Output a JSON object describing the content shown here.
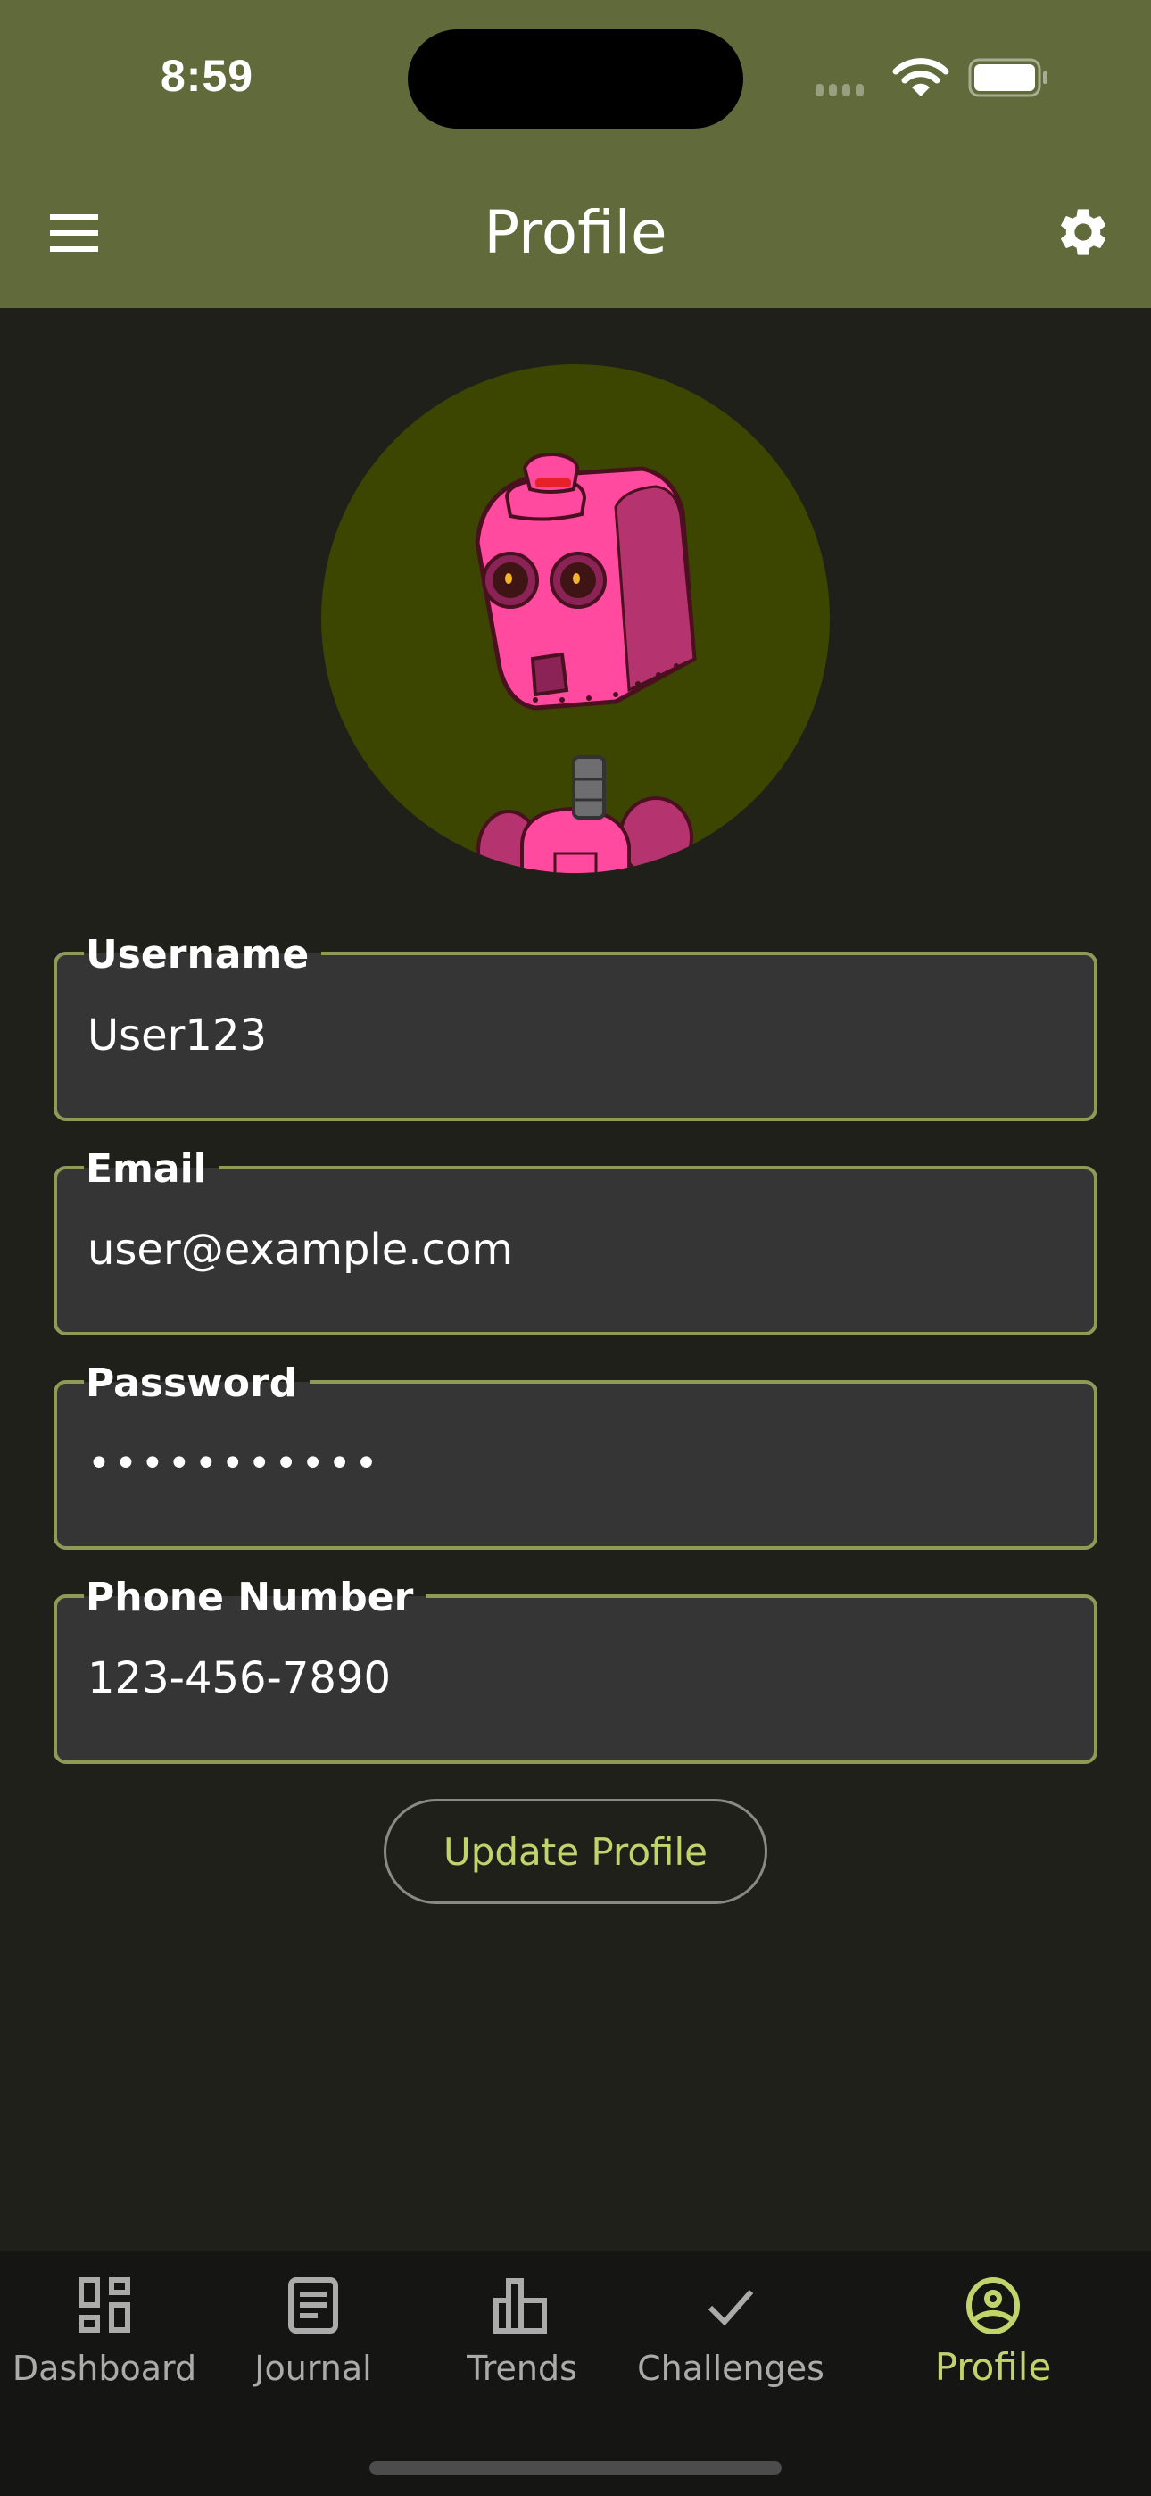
{
  "status_bar": {
    "time": "8:59"
  },
  "app_bar": {
    "title": "Profile",
    "menu_icon": "hamburger-menu-icon",
    "settings_icon": "gear-icon"
  },
  "avatar": {
    "description": "pink cartoon robot avatar",
    "background_color": "#3c4600"
  },
  "form": {
    "fields": [
      {
        "label": "Username",
        "value": "User123"
      },
      {
        "label": "Email",
        "value": "user@example.com"
      },
      {
        "label": "Password",
        "value": "•••••••••••"
      },
      {
        "label": "Phone Number",
        "value": "123-456-7890"
      }
    ],
    "submit_label": "Update Profile"
  },
  "bottom_nav": {
    "items": [
      {
        "label": "Dashboard",
        "icon": "dashboard-icon",
        "active": false
      },
      {
        "label": "Journal",
        "icon": "journal-icon",
        "active": false
      },
      {
        "label": "Trends",
        "icon": "bar-chart-icon",
        "active": false
      },
      {
        "label": "Challenges",
        "icon": "checkmark-icon",
        "active": false
      },
      {
        "label": "Profile",
        "icon": "account-circle-icon",
        "active": true
      }
    ]
  },
  "colors": {
    "app_bar": "#616a3b",
    "background": "#1f201a",
    "field_fill": "#353535",
    "field_border": "#8e9a55",
    "accent": "#c1d46b",
    "nav_background": "#151513",
    "nav_inactive": "#ababab"
  }
}
